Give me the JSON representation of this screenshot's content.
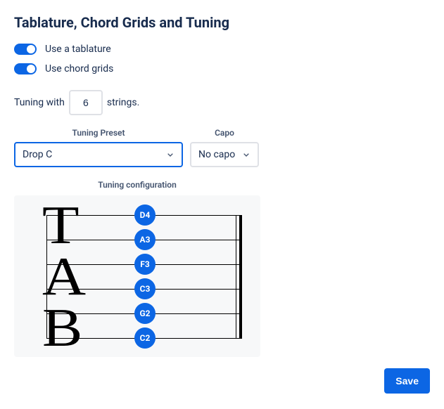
{
  "title": "Tablature, Chord Grids and Tuning",
  "toggles": {
    "tablature_label": "Use a tablature",
    "chord_grids_label": "Use chord grids"
  },
  "tuning_with": {
    "prefix": "Tuning with",
    "value": "6",
    "suffix": "strings."
  },
  "tuning_preset": {
    "label": "Tuning Preset",
    "value": "Drop C"
  },
  "capo": {
    "label": "Capo",
    "value": "No capo"
  },
  "tuning_config": {
    "label": "Tuning configuration",
    "notes": [
      "D4",
      "A3",
      "F3",
      "C3",
      "G2",
      "C2"
    ]
  },
  "footer": {
    "save_label": "Save"
  }
}
